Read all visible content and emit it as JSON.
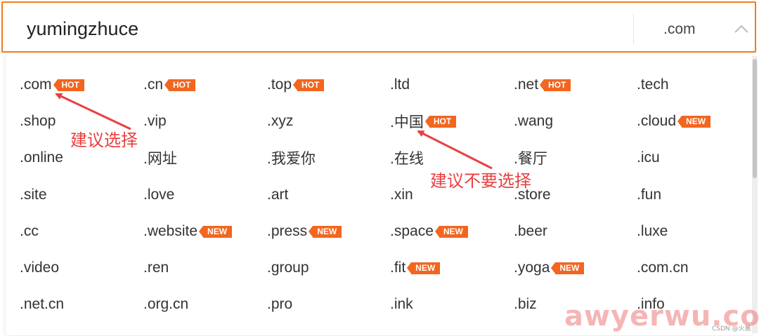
{
  "search": {
    "query": "yumingzhuce",
    "selected_tld": ".com",
    "chevron_icon": "chevron-up-icon"
  },
  "colors": {
    "accent": "#f07c1c",
    "badge": "#f2661f",
    "annotation": "#e8403f"
  },
  "rows": [
    [
      {
        "tld": ".com",
        "badge": "HOT"
      },
      {
        "tld": ".cn",
        "badge": "HOT"
      },
      {
        "tld": ".top",
        "badge": "HOT"
      },
      {
        "tld": ".ltd",
        "badge": ""
      },
      {
        "tld": ".net",
        "badge": "HOT"
      },
      {
        "tld": ".tech",
        "badge": ""
      }
    ],
    [
      {
        "tld": ".shop",
        "badge": ""
      },
      {
        "tld": ".vip",
        "badge": ""
      },
      {
        "tld": ".xyz",
        "badge": ""
      },
      {
        "tld": ".中国",
        "badge": "HOT"
      },
      {
        "tld": ".wang",
        "badge": ""
      },
      {
        "tld": ".cloud",
        "badge": "NEW"
      }
    ],
    [
      {
        "tld": ".online",
        "badge": ""
      },
      {
        "tld": ".网址",
        "badge": ""
      },
      {
        "tld": ".我爱你",
        "badge": ""
      },
      {
        "tld": ".在线",
        "badge": ""
      },
      {
        "tld": ".餐厅",
        "badge": ""
      },
      {
        "tld": ".icu",
        "badge": ""
      }
    ],
    [
      {
        "tld": ".site",
        "badge": ""
      },
      {
        "tld": ".love",
        "badge": ""
      },
      {
        "tld": ".art",
        "badge": ""
      },
      {
        "tld": ".xin",
        "badge": ""
      },
      {
        "tld": ".store",
        "badge": ""
      },
      {
        "tld": ".fun",
        "badge": ""
      }
    ],
    [
      {
        "tld": ".cc",
        "badge": ""
      },
      {
        "tld": ".website",
        "badge": "NEW"
      },
      {
        "tld": ".press",
        "badge": "NEW"
      },
      {
        "tld": ".space",
        "badge": "NEW"
      },
      {
        "tld": ".beer",
        "badge": ""
      },
      {
        "tld": ".luxe",
        "badge": ""
      }
    ],
    [
      {
        "tld": ".video",
        "badge": ""
      },
      {
        "tld": ".ren",
        "badge": ""
      },
      {
        "tld": ".group",
        "badge": ""
      },
      {
        "tld": ".fit",
        "badge": "NEW"
      },
      {
        "tld": ".yoga",
        "badge": "NEW"
      },
      {
        "tld": ".com.cn",
        "badge": ""
      }
    ],
    [
      {
        "tld": ".net.cn",
        "badge": ""
      },
      {
        "tld": ".org.cn",
        "badge": ""
      },
      {
        "tld": ".pro",
        "badge": ""
      },
      {
        "tld": ".ink",
        "badge": ""
      },
      {
        "tld": ".biz",
        "badge": ""
      },
      {
        "tld": ".info",
        "badge": ""
      }
    ]
  ],
  "annotations": {
    "recommend": "建议选择",
    "not_recommend": "建议不要选择"
  },
  "watermark": "awyerwu.com",
  "credit": "CSDN @火凰"
}
